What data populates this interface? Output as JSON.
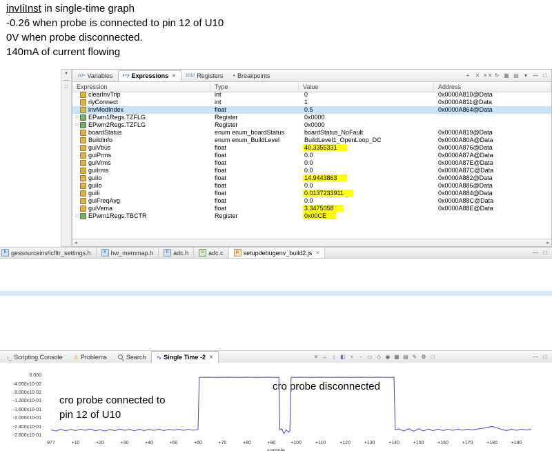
{
  "annotations": {
    "line1_term": "invIiInst",
    "line1_rest": " in single-time graph",
    "line2": "-0.26 when probe is connected to pin 12 of U10",
    "line3": "0V when probe disconnected.",
    "line4": "140mA of current flowing"
  },
  "left_strip": {
    "icons": [
      {
        "name": "strip-view-menu",
        "glyph": "▾",
        "color": "#555555"
      },
      {
        "name": "strip-minimize",
        "glyph": "—",
        "color": "#555555"
      },
      {
        "name": "strip-maximize",
        "glyph": "□",
        "color": "#555555"
      }
    ]
  },
  "expressions_panel": {
    "tabs": [
      {
        "label": "Variables",
        "icon": "(x)="
      },
      {
        "label": "Expressions",
        "icon": "x+y"
      },
      {
        "label": "Registers",
        "icon": "1010"
      },
      {
        "label": "Breakpoints",
        "icon": "●"
      }
    ],
    "close_glyph": "✕",
    "scroll_left": "◂",
    "scroll_right": "▸",
    "toolbar": [
      {
        "name": "add-expression",
        "glyph": "+",
        "color": "#2e8b2e"
      },
      {
        "name": "remove-expression",
        "glyph": "✕",
        "color": "#777777"
      },
      {
        "name": "remove-all-expressions",
        "glyph": "✕✕",
        "color": "#777777"
      },
      {
        "name": "refresh",
        "glyph": "↻",
        "color": "#3b6fb5"
      },
      {
        "name": "show-types",
        "glyph": "▦",
        "color": "#777777"
      },
      {
        "name": "collapse-all",
        "glyph": "▤",
        "color": "#777777"
      },
      {
        "name": "view-menu",
        "glyph": "▾",
        "color": "#555555"
      },
      {
        "name": "minimize-view",
        "glyph": "—",
        "color": "#555555"
      },
      {
        "name": "maximize-view",
        "glyph": "□",
        "color": "#555555"
      }
    ],
    "columns": [
      "Expression",
      "Type",
      "Value",
      "Address"
    ],
    "rows": [
      {
        "expression": "clearInvTrip",
        "type": "int",
        "value": "0",
        "address": "0x0000A810@Data"
      },
      {
        "expression": "rlyConnect",
        "type": "int",
        "value": "1",
        "address": "0x0000A811@Data"
      },
      {
        "expression": "invModIndex",
        "type": "float",
        "value": "0.5",
        "address": "0x0000A864@Data",
        "selected": true
      },
      {
        "expression": "EPwm1Regs.TZFLG",
        "type": "Register",
        "value": "0x0000",
        "address": "",
        "expandable": true
      },
      {
        "expression": "EPwm2Regs.TZFLG",
        "type": "Register",
        "value": "0x0000",
        "address": "",
        "expandable": true
      },
      {
        "expression": "boardStatus",
        "type": "enum enum_boardStatus",
        "value": "boardStatus_NoFault",
        "address": "0x0000A819@Data"
      },
      {
        "expression": "BuildInfo",
        "type": "enum enum_BuildLevel",
        "value": "BuildLevel1_OpenLoop_DC",
        "address": "0x0000A80A@Data"
      },
      {
        "expression": "guiVbus",
        "type": "float",
        "value": "40.3355331",
        "address": "0x0000A876@Data",
        "highlight": true
      },
      {
        "expression": "guiPrms",
        "type": "float",
        "value": "0.0",
        "address": "0x0000A87A@Data"
      },
      {
        "expression": "guiVrms",
        "type": "float",
        "value": "0.0",
        "address": "0x0000A87E@Data"
      },
      {
        "expression": "guiIrms",
        "type": "float",
        "value": "0.0",
        "address": "0x0000A87C@Data"
      },
      {
        "expression": "guiIo",
        "type": "float",
        "value": "14.9443863",
        "address": "0x0000A882@Data",
        "highlight": true
      },
      {
        "expression": "guiIo",
        "type": "float",
        "value": "0.0",
        "address": "0x0000A886@Data"
      },
      {
        "expression": "guiIi",
        "type": "float",
        "value": "0.0137233911",
        "address": "0x0000A884@Data",
        "highlight": true
      },
      {
        "expression": "guiFreqAvg",
        "type": "float",
        "value": "0.0",
        "address": "0x0000A88C@Data"
      },
      {
        "expression": "guiVema",
        "type": "float",
        "value": "3.3475058",
        "address": "0x0000A88E@Data",
        "highlight": true
      },
      {
        "expression": "EPwm1Regs.TBCTR",
        "type": "Register",
        "value": "0x00CE",
        "address": "",
        "expandable": true,
        "highlight": true
      }
    ]
  },
  "editor": {
    "close_glyph": "✕",
    "tabs": [
      {
        "label": "gessourceinv/icfltr_settings.h",
        "ftype": "h"
      },
      {
        "label": "hw_memmap.h",
        "ftype": "h"
      },
      {
        "label": "adc.h",
        "ftype": "h"
      },
      {
        "label": "adc.c",
        "ftype": "c"
      },
      {
        "label": "setupdebugenv_build2.js",
        "ftype": "js",
        "active": true
      }
    ],
    "window_icons": [
      {
        "name": "minimize-editor",
        "glyph": "—",
        "color": "#555555"
      },
      {
        "name": "maximize-editor",
        "glyph": "□",
        "color": "#555555"
      }
    ]
  },
  "bottom_panel": {
    "close_glyph": "✕",
    "tabs": [
      {
        "label": "Scripting Console",
        "iconname": "scripting-console-icon",
        "icon": "›_",
        "iconcolor": "#3b6fb5"
      },
      {
        "label": "Problems",
        "iconname": "problems-icon",
        "icon": "⚠",
        "iconcolor": "#e09000"
      },
      {
        "label": "Search",
        "iconname": "search-icon",
        "icon": "",
        "iconcolor": "#666666"
      },
      {
        "label": "Single Time -2",
        "iconname": "single-time-icon",
        "icon": "∿",
        "iconcolor": "#3b6fb5",
        "active": true
      }
    ],
    "toolbar": [
      {
        "name": "legend",
        "glyph": "≡",
        "color": "#555555"
      },
      {
        "name": "cursor-horizontal",
        "glyph": "↔",
        "color": "#3b6fb5"
      },
      {
        "name": "cursor-vertical",
        "glyph": "↕",
        "color": "#3b6fb5"
      },
      {
        "name": "measurement",
        "glyph": "◧",
        "color": "#7a5fb0"
      },
      {
        "name": "zoom-in",
        "glyph": "+",
        "color": "#2e8b2e"
      },
      {
        "name": "zoom-out",
        "glyph": "−",
        "color": "#c06030"
      },
      {
        "name": "zoom-fit",
        "glyph": "▭",
        "color": "#3b6fb5"
      },
      {
        "name": "pan",
        "glyph": "◇",
        "color": "#666666"
      },
      {
        "name": "camera",
        "glyph": "◉",
        "color": "#666666"
      },
      {
        "name": "grid",
        "glyph": "▦",
        "color": "#666666"
      },
      {
        "name": "export",
        "glyph": "▤",
        "color": "#666666"
      },
      {
        "name": "properties",
        "glyph": "✎",
        "color": "#8a6d3b"
      },
      {
        "name": "settings",
        "glyph": "⚙",
        "color": "#555555"
      },
      {
        "name": "maximize-panel",
        "glyph": "□",
        "color": "#555555"
      }
    ],
    "note_disconnected": "cro probe disconnected",
    "note_connected_line1": "cro probe connected to",
    "note_connected_line2": "pin 12 of U10"
  },
  "chart_data": {
    "type": "line",
    "title": "Single Time -2",
    "xlabel": "sample",
    "ylabel": "",
    "legend": false,
    "grid": false,
    "line_color": "#4545b8",
    "xlim": [
      0,
      196
    ],
    "ylim": [
      -0.296,
      0.013
    ],
    "x_start_label": "977",
    "x_ticks": [
      {
        "label": "977",
        "s": 0
      },
      {
        "label": "+10",
        "s": 10
      },
      {
        "label": "+20",
        "s": 20
      },
      {
        "label": "+30",
        "s": 30
      },
      {
        "label": "+40",
        "s": 40
      },
      {
        "label": "+50",
        "s": 50
      },
      {
        "label": "+60",
        "s": 60
      },
      {
        "label": "+70",
        "s": 70
      },
      {
        "label": "+80",
        "s": 80
      },
      {
        "label": "+90",
        "s": 90
      },
      {
        "label": "+100",
        "s": 100
      },
      {
        "label": "+110",
        "s": 110
      },
      {
        "label": "+120",
        "s": 120
      },
      {
        "label": "+130",
        "s": 130
      },
      {
        "label": "+140",
        "s": 140
      },
      {
        "label": "+150",
        "s": 150
      },
      {
        "label": "+160",
        "s": 160
      },
      {
        "label": "+170",
        "s": 170
      },
      {
        "label": "+180",
        "s": 180
      },
      {
        "label": "+190",
        "s": 190
      }
    ],
    "y_ticks": [
      {
        "label": "0.000",
        "v": 0
      },
      {
        "label": "-4.000x10-02",
        "v": -0.04
      },
      {
        "label": "-8.000x10-02",
        "v": -0.08
      },
      {
        "label": "-1.200x10-01",
        "v": -0.12
      },
      {
        "label": "-1.600x10-01",
        "v": -0.16
      },
      {
        "label": "-2.000x10-01",
        "v": -0.2
      },
      {
        "label": "-2.400x10-01",
        "v": -0.24
      },
      {
        "label": "-2.800x10-01",
        "v": -0.28
      }
    ],
    "series": [
      {
        "name": "invIiInst",
        "points": [
          [
            0,
            -0.249
          ],
          [
            2,
            -0.254
          ],
          [
            4,
            -0.246
          ],
          [
            6,
            -0.253
          ],
          [
            8,
            -0.247
          ],
          [
            10,
            -0.252
          ],
          [
            12,
            -0.246
          ],
          [
            14,
            -0.251
          ],
          [
            16,
            -0.245
          ],
          [
            18,
            -0.253
          ],
          [
            20,
            -0.248
          ],
          [
            22,
            -0.254
          ],
          [
            24,
            -0.247
          ],
          [
            26,
            -0.252
          ],
          [
            28,
            -0.246
          ],
          [
            30,
            -0.251
          ],
          [
            32,
            -0.247
          ],
          [
            34,
            -0.253
          ],
          [
            36,
            -0.246
          ],
          [
            38,
            -0.252
          ],
          [
            40,
            -0.247
          ],
          [
            42,
            -0.251
          ],
          [
            44,
            -0.246
          ],
          [
            46,
            -0.252
          ],
          [
            48,
            -0.247
          ],
          [
            50,
            -0.25
          ],
          [
            52,
            -0.246
          ],
          [
            54,
            -0.251
          ],
          [
            56,
            -0.247
          ],
          [
            58,
            -0.25
          ],
          [
            60,
            -0.248
          ],
          [
            60.5,
            -0.004
          ],
          [
            64,
            -0.003
          ],
          [
            68,
            -0.004
          ],
          [
            72,
            -0.003
          ],
          [
            76,
            -0.004
          ],
          [
            80,
            -0.003
          ],
          [
            84,
            -0.004
          ],
          [
            88,
            -0.003
          ],
          [
            92,
            -0.004
          ],
          [
            93,
            -0.003
          ],
          [
            93.4,
            -0.25
          ],
          [
            94.2,
            -0.244
          ],
          [
            95,
            -0.266
          ],
          [
            96,
            -0.249
          ],
          [
            97,
            -0.26
          ],
          [
            97.5,
            -0.252
          ],
          [
            98,
            -0.004
          ],
          [
            102,
            -0.003
          ],
          [
            106,
            -0.004
          ],
          [
            110,
            -0.003
          ],
          [
            114,
            -0.004
          ],
          [
            118,
            -0.003
          ],
          [
            122,
            -0.004
          ],
          [
            126,
            -0.003
          ],
          [
            130,
            -0.004
          ],
          [
            134,
            -0.003
          ],
          [
            138,
            -0.004
          ],
          [
            140,
            -0.003
          ],
          [
            140.5,
            -0.248
          ],
          [
            142,
            -0.245
          ],
          [
            144,
            -0.254
          ],
          [
            146,
            -0.244
          ],
          [
            148,
            -0.255
          ],
          [
            150,
            -0.244
          ],
          [
            152,
            -0.254
          ],
          [
            154,
            -0.245
          ],
          [
            156,
            -0.253
          ],
          [
            158,
            -0.245
          ],
          [
            160,
            -0.252
          ],
          [
            162,
            -0.246
          ],
          [
            164,
            -0.251
          ],
          [
            166,
            -0.246
          ],
          [
            168,
            -0.25
          ],
          [
            170,
            -0.246
          ],
          [
            172,
            -0.249
          ],
          [
            174,
            -0.245
          ],
          [
            176,
            -0.242
          ],
          [
            178,
            -0.237
          ],
          [
            180,
            -0.233
          ],
          [
            182,
            -0.239
          ],
          [
            184,
            -0.247
          ],
          [
            186,
            -0.252
          ],
          [
            188,
            -0.246
          ],
          [
            190,
            -0.251
          ],
          [
            192,
            -0.246
          ],
          [
            194,
            -0.249
          ],
          [
            196,
            -0.247
          ]
        ]
      }
    ]
  }
}
